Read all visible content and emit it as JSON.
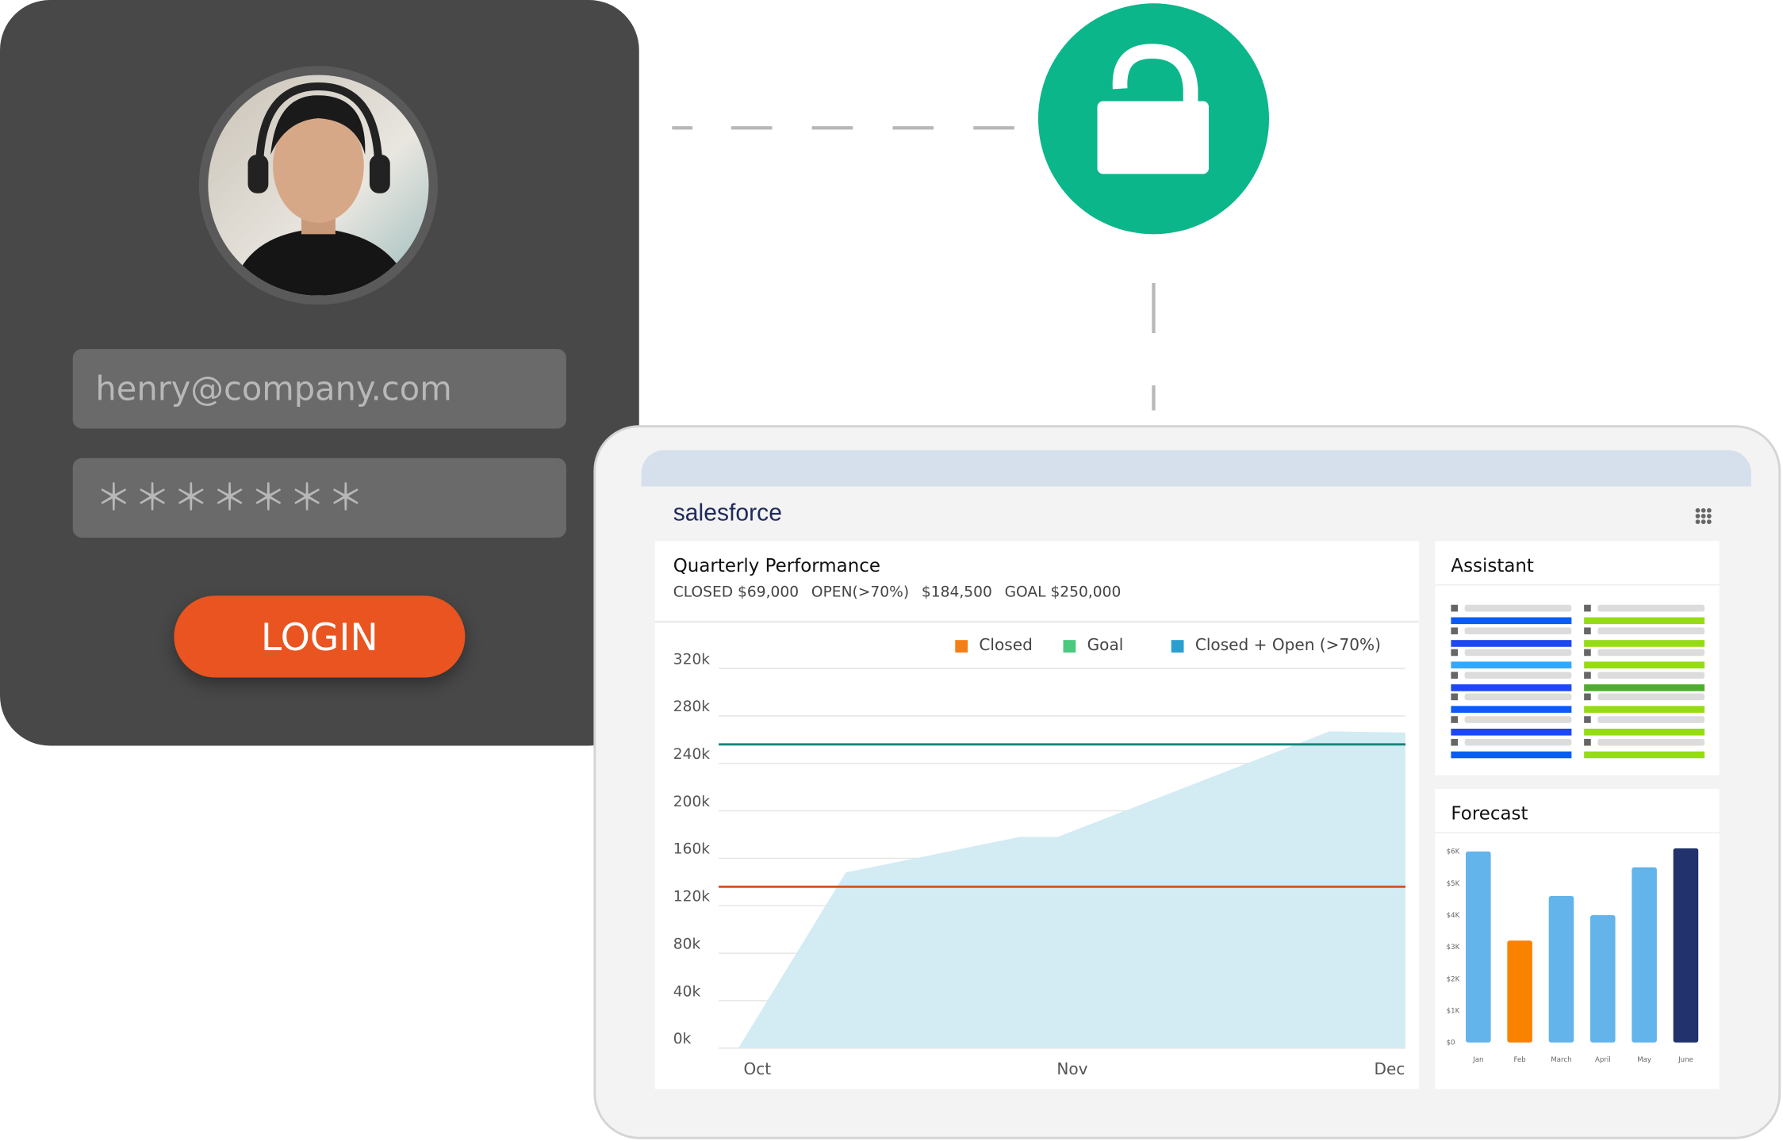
{
  "login": {
    "email_value": "henry@company.com",
    "password_value": "＊＊＊＊＊＊＊",
    "login_label": "LOGIN",
    "accent": "#e95420"
  },
  "lock": {
    "icon": "unlocked-padlock-icon",
    "color": "#0bb68a"
  },
  "dashboard": {
    "logo": "salesforce",
    "apps_icon": "app-grid-icon",
    "quarterly": {
      "title": "Quarterly Performance",
      "stats": [
        "CLOSED $69,000",
        "OPEN(>70%)",
        "$184,500",
        "GOAL $250,000"
      ]
    },
    "assistant": {
      "title": "Assistant",
      "left_colors": [
        "#0b5cf5",
        "#1d47f2",
        "#33a8fb",
        "#1d47f2",
        "#0b5cf5",
        "#1d47f2",
        "#0b5cf5"
      ],
      "right_colors": [
        "#96dc14",
        "#96dc14",
        "#96dc14",
        "#4fad2e",
        "#96dc14",
        "#96dc14",
        "#96dc14"
      ]
    },
    "forecast": {
      "title": "Forecast"
    }
  },
  "chart_data": [
    {
      "type": "area",
      "title": "Quarterly Performance",
      "legend": [
        "Closed",
        "Goal",
        "Closed + Open (>70%)"
      ],
      "legend_colors": [
        "#f57f17",
        "#4bc97f",
        "#2a9fd0"
      ],
      "legend_placement": "top-right",
      "x_ticks": [
        "Oct",
        "Nov",
        "Dec"
      ],
      "y_ticks": [
        "0k",
        "40k",
        "80k",
        "120k",
        "160k",
        "200k",
        "240k",
        "280k",
        "320k"
      ],
      "ylim": [
        0,
        320
      ],
      "grid": true,
      "series": [
        {
          "name": "Closed + Open (>70%)",
          "color": "#d3ebf3",
          "x": [
            -0.06,
            0.28,
            0.83,
            0.95,
            1.81,
            2.05
          ],
          "y": [
            0,
            148,
            178,
            178,
            267,
            266
          ]
        },
        {
          "name": "Goal",
          "type": "hline",
          "color": "#14857a",
          "y": 256
        },
        {
          "name": "Closed",
          "type": "hline",
          "color": "#d2532a",
          "y": 136
        }
      ]
    },
    {
      "type": "bar",
      "title": "Forecast",
      "categories": [
        "Jan",
        "Feb",
        "March",
        "April",
        "May",
        "June"
      ],
      "values": [
        6.0,
        3.2,
        4.6,
        4.0,
        5.5,
        6.1
      ],
      "colors": [
        "#62b4ea",
        "#fb8200",
        "#62b4ea",
        "#62b4ea",
        "#62b4ea",
        "#22326c"
      ],
      "y_ticks": [
        "$0",
        "$1K",
        "$2K",
        "$3K",
        "$4K",
        "$5K",
        "$6K"
      ],
      "ylim": [
        0,
        6
      ]
    }
  ]
}
